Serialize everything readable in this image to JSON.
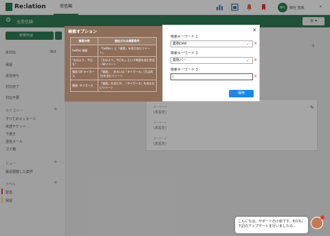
{
  "header": {
    "logo_text": "Re:lation",
    "inbox_tab": "受信箱",
    "user_initials": "御社",
    "user_name": "御社 智哉"
  },
  "subheader": {
    "title": "全受信箱",
    "settings_button": "⚙ ▾"
  },
  "sidebar": {
    "new_button": "新規作成",
    "items": [
      {
        "label": "未対応",
        "count": "363"
      },
      {
        "label": "保留",
        "count": ""
      },
      {
        "label": "返信待ち",
        "count": ""
      },
      {
        "label": "対応完了",
        "count": ""
      },
      {
        "label": "対応不要",
        "count": ""
      }
    ],
    "section_categories": "カテゴリー",
    "category_items": [
      "すべてのメッセージ",
      "未読チケット",
      "下書き",
      "送信メール",
      "ゴミ箱"
    ],
    "section_views": "ビュー",
    "view_items": [
      "最近閲覧した案件"
    ],
    "section_labels": "ラベル",
    "label_items": [
      {
        "label": "緊急",
        "color": "#e53935"
      },
      {
        "label": "保留",
        "color": "#fdd835"
      }
    ]
  },
  "card": {
    "rows": [
      {
        "label": "キーワード",
        "value": "(未設定)"
      },
      {
        "label": "キーワード",
        "value": "(未設定)"
      },
      {
        "label": "キーワード",
        "value": "(未設定)"
      }
    ]
  },
  "popover": {
    "title": "検索オプション",
    "headers": [
      "検索の例",
      "抽出される検索条件"
    ],
    "rows": [
      [
        "twitter 検索",
        "「twitter」と「検索」を両方含むツイート。"
      ],
      [
        "\"おはよう、今日も\"",
        "「おはよう、今日も」という単語を含む完全一致ツイート"
      ],
      [
        "猫画 OR タイガース",
        "「猫画」、あるいは「タイガース」(又は両方)を含むツイート"
      ],
      [
        "猫画 -タイガース",
        "「猫画」を含むが、「タイガース」を含まないツイート"
      ]
    ]
  },
  "modal": {
    "fields": [
      {
        "label": "検索キーワード 1",
        "value": "業務DAR",
        "placeholder": ""
      },
      {
        "label": "検索キーワード 2",
        "value": "業務パー",
        "placeholder": ""
      },
      {
        "label": "検索キーワード 3",
        "value": "|",
        "placeholder": ""
      }
    ],
    "save_label": "保存"
  },
  "chat": {
    "message": "こんにちは。サポートの小松です。8/13に下記のアップデートを行いましたの..."
  }
}
